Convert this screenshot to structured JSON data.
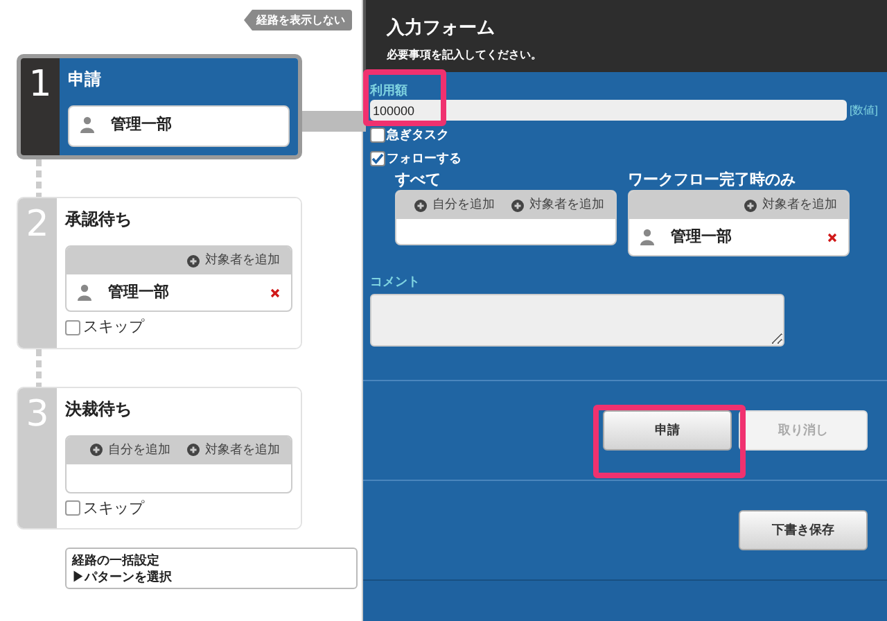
{
  "route_toggle": "経路を表示しない",
  "steps": [
    {
      "number": "1",
      "title": "申請",
      "selected": true,
      "assignees": [
        {
          "name": "管理一部",
          "removable": false
        }
      ]
    },
    {
      "number": "2",
      "title": "承認待ち",
      "selected": false,
      "actions": [
        "対象者を追加"
      ],
      "assignees": [
        {
          "name": "管理一部",
          "removable": true
        }
      ],
      "skip": {
        "label": "スキップ",
        "checked": false
      }
    },
    {
      "number": "3",
      "title": "決裁待ち",
      "selected": false,
      "actions": [
        "自分を追加",
        "対象者を追加"
      ],
      "skip": {
        "label": "スキップ",
        "checked": false
      }
    }
  ],
  "bulk_setting": {
    "title": "経路の一括設定",
    "link": "▶パターンを選択"
  },
  "form": {
    "title": "入力フォーム",
    "subtitle": "必要事項を記入してください。",
    "amount": {
      "label": "利用額",
      "value": "100000",
      "unit": "[数値]"
    },
    "options": [
      {
        "label": "急ぎタスク",
        "checked": false
      },
      {
        "label": "フォローする",
        "checked": true
      }
    ],
    "follow_groups": [
      {
        "title": "すべて",
        "actions": [
          "自分を追加",
          "対象者を追加"
        ]
      },
      {
        "title": "ワークフロー完了時のみ",
        "actions": [
          "対象者を追加"
        ],
        "assignees": [
          {
            "name": "管理一部",
            "removable": true
          }
        ]
      }
    ],
    "comment": {
      "label": "コメント"
    },
    "buttons": [
      {
        "label": "申請",
        "disabled": false
      },
      {
        "label": "取り消し",
        "disabled": true
      }
    ],
    "draft_button": {
      "label": "下書き保存"
    }
  }
}
